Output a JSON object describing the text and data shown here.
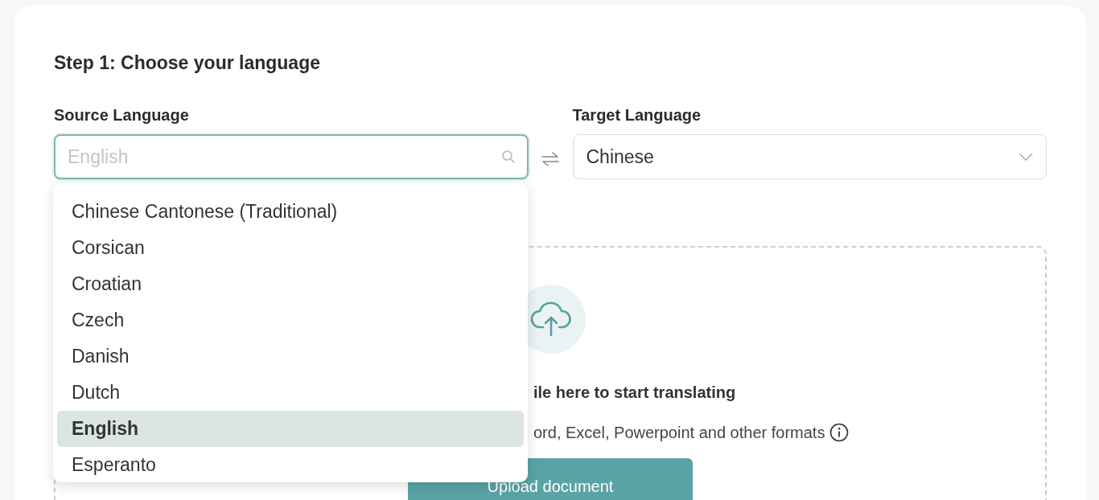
{
  "step_title": "Step 1: Choose your language",
  "source": {
    "label": "Source Language",
    "placeholder": "English"
  },
  "target": {
    "label": "Target Language",
    "value": "Chinese"
  },
  "source_options": [
    {
      "label": "Chinese Cantonese (Traditional)",
      "selected": false
    },
    {
      "label": "Corsican",
      "selected": false
    },
    {
      "label": "Croatian",
      "selected": false
    },
    {
      "label": "Czech",
      "selected": false
    },
    {
      "label": "Danish",
      "selected": false
    },
    {
      "label": "Dutch",
      "selected": false
    },
    {
      "label": "English",
      "selected": true
    },
    {
      "label": "Esperanto",
      "selected": false
    }
  ],
  "drop_zone": {
    "title": "ile here to start translating",
    "subtitle": "ord, Excel, Powerpoint and other formats",
    "button": "Upload document"
  }
}
